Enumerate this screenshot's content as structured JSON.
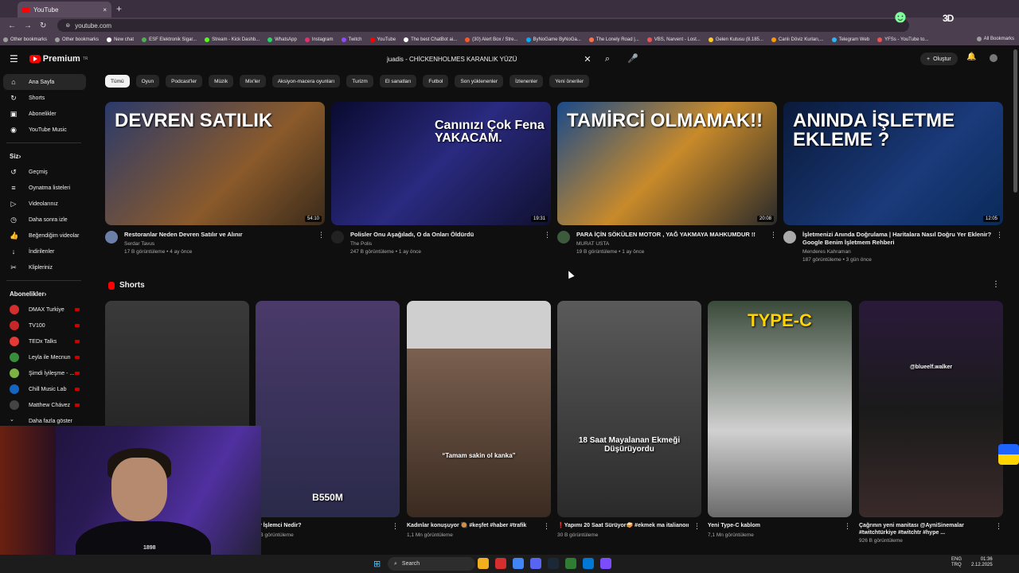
{
  "browser": {
    "tab_title": "YouTube",
    "tab_close": "×",
    "new_tab": "+",
    "url": "youtube.com",
    "bookmarks": [
      "Other bookmarks",
      "Other bookmarks",
      "New chat",
      "ESF Elektronik Sigar...",
      "Stream - Kick Dashb...",
      "WhatsApp",
      "Instagram",
      "Twitch",
      "YouTube",
      "The best ChatBot ai...",
      "(30) Alert Box / Stre...",
      "ByNoGame ByNoGa...",
      "The Lonely Road |...",
      "VBS, Narvent - Lost...",
      "Gelen Kutusu (8.185...",
      "Canlı Döviz Kurları,...",
      "Telegram Web",
      "YFSs - YouTube to...",
      "All Bookmarks"
    ]
  },
  "header": {
    "brand": "Premium",
    "brand_sup": "TR",
    "search_query": "juadis - CHİCKENHOLMES KARANLIK YÜZÜ",
    "create_label": "Oluştur",
    "icons": [
      "menu-icon",
      "search-icon",
      "mic-icon",
      "bell-icon"
    ]
  },
  "sidebar": {
    "main": [
      {
        "label": "Ana Sayfa",
        "icon": "⌂"
      },
      {
        "label": "Shorts",
        "icon": "↻"
      },
      {
        "label": "Abonelikler",
        "icon": "▣"
      },
      {
        "label": "YouTube Music",
        "icon": "◉"
      }
    ],
    "you_heading": "Siz",
    "you": [
      {
        "label": "Geçmiş",
        "icon": "↺"
      },
      {
        "label": "Oynatma listeleri",
        "icon": "≡"
      },
      {
        "label": "Videolarınız",
        "icon": "▷"
      },
      {
        "label": "Daha sonra izle",
        "icon": "◷"
      },
      {
        "label": "Beğendiğim videolar",
        "icon": "👍"
      },
      {
        "label": "İndirilenler",
        "icon": "↓"
      },
      {
        "label": "Klipleriniz",
        "icon": "✂"
      }
    ],
    "subs_heading": "Abonelikler",
    "subs": [
      {
        "label": "DMAX Turkiye",
        "color": "#d32f2f"
      },
      {
        "label": "TV100",
        "color": "#c62828"
      },
      {
        "label": "TEDx Talks",
        "color": "#e53935"
      },
      {
        "label": "Leyla ile Mecnun",
        "color": "#388e3c"
      },
      {
        "label": "Şimdi İyileşme - ...",
        "color": "#7cb342"
      },
      {
        "label": "Chill Music Lab",
        "color": "#1565c0"
      },
      {
        "label": "Matthew Chávez",
        "color": "#444444"
      }
    ],
    "more_label": "Daha fazla göster"
  },
  "chips": [
    "Tümü",
    "Oyun",
    "Podcast'ler",
    "Müzik",
    "Mix'ler",
    "Aksiyon-macera oyunları",
    "Turizm",
    "El sanatları",
    "Futbol",
    "Son yüklenenler",
    "İzlenenler",
    "Yeni öneriler"
  ],
  "videos": [
    {
      "overlay": "DEVREN SATILIK",
      "duration": "54:10",
      "title": "Restoranlar Neden Devren Satılır ve Alınır",
      "channel": "Serdar Tavus",
      "stats": "17 B görüntüleme • 4 ay önce",
      "bg": "linear-gradient(135deg,#2b3a6b,#8a5a2b 60%,#3a2a1a)",
      "avatar": "#6b7fa8"
    },
    {
      "overlay": "Canınızı Çok Fena YAKACAM.",
      "duration": "19:31",
      "title": "Polisler Onu Aşağıladı, O da Onları Öldürdü",
      "channel": "The Polis",
      "stats": "247 B görüntüleme • 1 ay önce",
      "bg": "linear-gradient(135deg,#0a0a30,#2a2a80 50%,#101030)",
      "avatar": "#222222"
    },
    {
      "overlay": "TAMİRCİ OLMAMAK!!",
      "duration": "20:08",
      "title": "PARA İÇİN SÖKÜLEN MOTOR , YAĞ YAKMAYA MAHKUMDUR !!",
      "channel": "MURAT USTA",
      "stats": "19 B görüntüleme • 1 ay önce",
      "bg": "linear-gradient(135deg,#1a4a8a,#c88a2a 50%,#2a2a2a)",
      "avatar": "#3d5a3d"
    },
    {
      "overlay": "ANINDA İŞLETME EKLEME ?",
      "duration": "12:05",
      "title": "İşletmenizi Anında Doğrulama | Haritalara Nasıl Doğru Yer Eklenir? Google Benim İşletmem Rehberi",
      "channel": "Menderes Kahraman",
      "stats": "187 görüntüleme • 3 gün önce",
      "bg": "linear-gradient(135deg,#0a1a3a,#1a3a7a 60%,#0a2a5a)",
      "avatar": "#aaaaaa"
    }
  ],
  "shorts_heading": "Shorts",
  "shorts": [
    {
      "title": "",
      "views": "",
      "text": "",
      "bg": "linear-gradient(180deg,#3a3a3a,#1a1a1a)"
    },
    {
      "title": "ay İşlemci Nedir?",
      "views": "7 B görüntüleme",
      "text": "B550M",
      "bg": "linear-gradient(180deg,#4a3a6a,#2a2a4a)"
    },
    {
      "title": "Kadınlar konuşuyor 🥘 #keşfet #haber #trafik",
      "views": "1,1 Mn görüntüleme",
      "text": "“Tamam sakin ol kanka”",
      "bg": "linear-gradient(180deg,#cfcfcf 0%,#cfcfcf 22%,#7a6050 22%,#3a2a20)"
    },
    {
      "title": "❗Yapımı 20 Saat Sürüyor🥪 #ekmek ma italianoıı",
      "views": "30 B görüntüleme",
      "text": "18 Saat Mayalanan Ekmeği Düşürüyordu",
      "bg": "linear-gradient(180deg,#5a5a5a,#2a2a2a)"
    },
    {
      "title": "Yeni Type-C kablom",
      "views": "7,1 Mn görüntüleme",
      "text": "TYPE-C",
      "bg": "linear-gradient(180deg,#3a4a3a,#d0d0d0 60%,#6a6a6a)"
    },
    {
      "title": "Çağrının yeni manitası @AyniSinemalar #twitchtürkiye #twitchtr #hype ...",
      "views": "926 B görüntüleme",
      "text": "@blueelf.walker",
      "bg": "linear-gradient(180deg,#2a1a3a,#1a1a1a 50%,#3a2a2a)"
    }
  ],
  "taskbar": {
    "search_label": "Search",
    "lang": "ENG\nTRQ",
    "time": "01:36",
    "date": "2.12.2025"
  }
}
